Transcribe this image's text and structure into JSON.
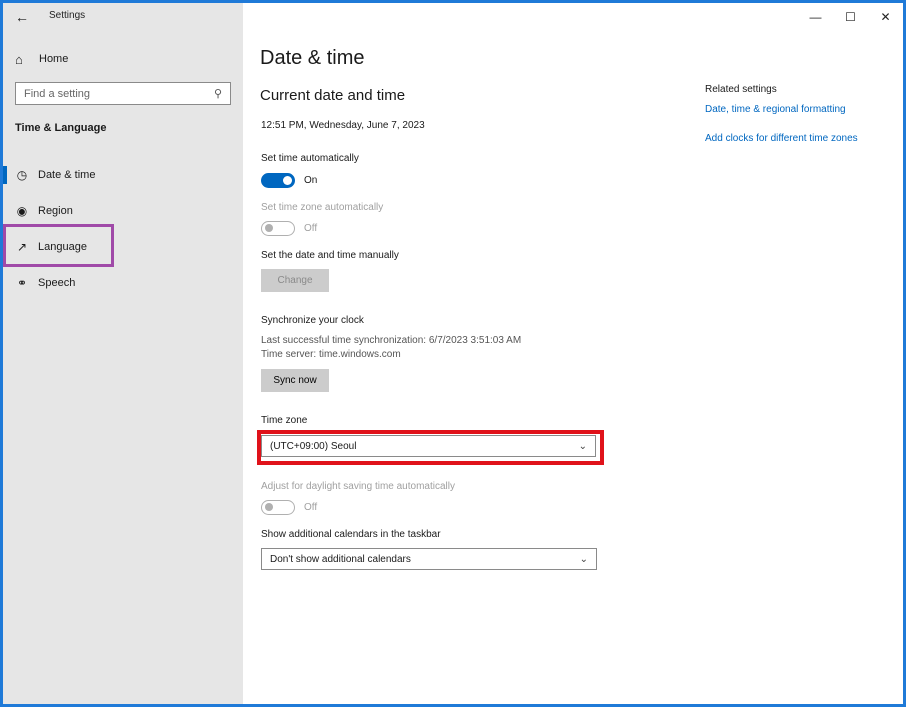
{
  "window": {
    "title": "Settings"
  },
  "sidebar": {
    "home": "Home",
    "search_placeholder": "Find a setting",
    "section": "Time & Language",
    "items": [
      {
        "label": "Date & time",
        "icon": "calendar-clock-icon"
      },
      {
        "label": "Region",
        "icon": "globe-icon"
      },
      {
        "label": "Language",
        "icon": "language-icon"
      },
      {
        "label": "Speech",
        "icon": "microphone-icon"
      }
    ]
  },
  "main": {
    "title": "Date & time",
    "subtitle": "Current date and time",
    "current_datetime": "12:51 PM, Wednesday, June 7, 2023",
    "set_time_auto": {
      "label": "Set time automatically",
      "state": "On"
    },
    "set_tz_auto": {
      "label": "Set time zone automatically",
      "state": "Off"
    },
    "manual": {
      "label": "Set the date and time manually",
      "button": "Change"
    },
    "sync": {
      "heading": "Synchronize your clock",
      "last_sync": "Last successful time synchronization: 6/7/2023 3:51:03 AM",
      "server": "Time server: time.windows.com",
      "button": "Sync now"
    },
    "time_zone": {
      "label": "Time zone",
      "value": "(UTC+09:00) Seoul"
    },
    "dst": {
      "label": "Adjust for daylight saving time automatically",
      "state": "Off"
    },
    "calendars": {
      "label": "Show additional calendars in the taskbar",
      "value": "Don't show additional calendars"
    }
  },
  "related": {
    "title": "Related settings",
    "links": [
      "Date, time & regional formatting",
      "Add clocks for different time zones"
    ]
  },
  "colors": {
    "accent": "#0067c0",
    "highlight_red": "#e0121a",
    "highlight_purple": "#a04aa8"
  }
}
